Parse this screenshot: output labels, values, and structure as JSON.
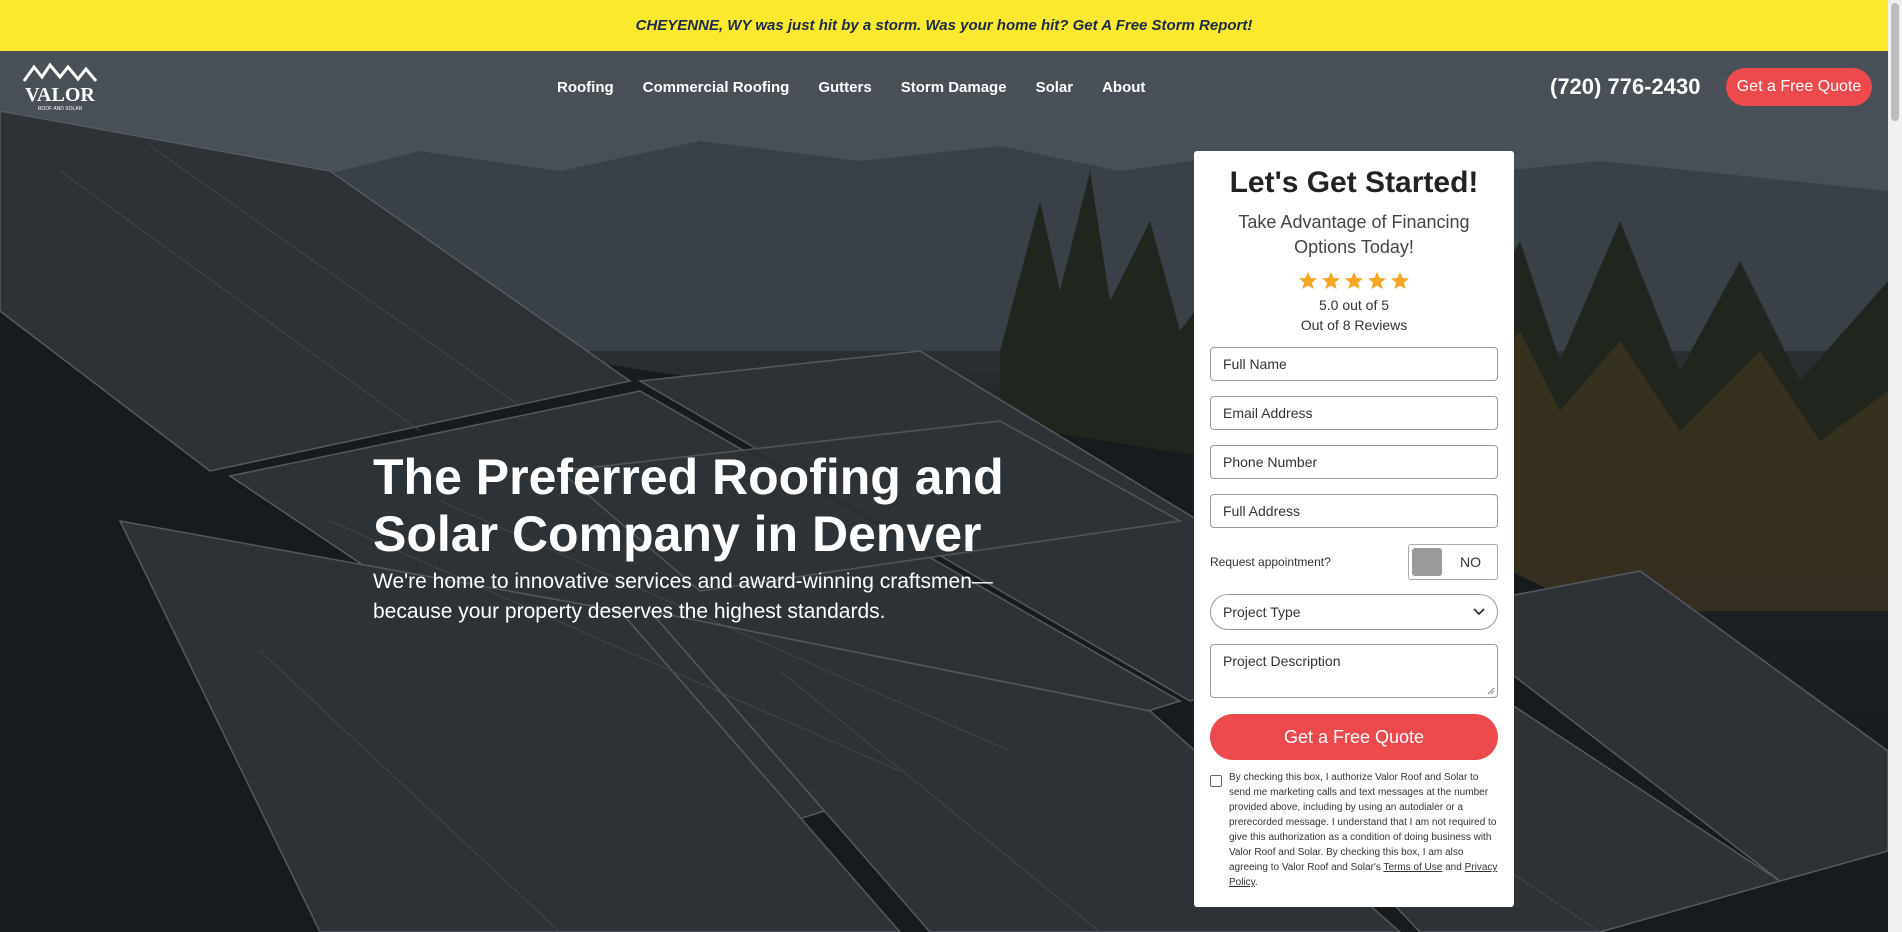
{
  "announcement": {
    "text": "CHEYENNE, WY was just hit by a storm. Was your home hit? Get A Free Storm Report!"
  },
  "header": {
    "logo_text": "VALOR",
    "logo_subtext": "ROOF AND SOLAR",
    "nav": [
      "Roofing",
      "Commercial Roofing",
      "Gutters",
      "Storm Damage",
      "Solar",
      "About"
    ],
    "phone": "(720) 776-2430",
    "cta_label": "Get a Free Quote"
  },
  "hero": {
    "headline": "The Preferred Roofing and Solar Company in Denver",
    "subhead": "We're home to innovative services and award-winning craftsmen—because your property deserves the highest standards."
  },
  "form": {
    "title": "Let's Get Started!",
    "subtitle": "Take Advantage of Financing Options Today!",
    "rating_value": 5.0,
    "rating_text": "5.0 out of 5",
    "reviews_text": "Out of 8 Reviews",
    "fields": {
      "full_name": "Full Name",
      "email": "Email Address",
      "phone": "Phone Number",
      "address": "Full Address"
    },
    "appointment_label": "Request appointment?",
    "appointment_toggle": "NO",
    "project_type": "Project Type",
    "project_description": "Project Description",
    "submit_label": "Get a Free Quote",
    "consent_text": "By checking this box, I authorize Valor Roof and Solar to send me marketing calls and text messages at the number provided above, including by using an autodialer or a prerecorded message. I understand that I am not required to give this authorization as a condition of doing business with Valor Roof and Solar. By checking this box, I am also agreeing to Valor Roof and Solar's",
    "terms_link": "Terms of Use",
    "and_text": "and",
    "privacy_link": "Privacy Policy",
    "period": "."
  },
  "colors": {
    "accent": "#ec4a4d",
    "banner": "#fbe92f",
    "banner_text": "#1b2a4a",
    "star": "#f5a623"
  },
  "icons": [
    "valor-logo",
    "star-icon",
    "chevron-down-icon"
  ]
}
